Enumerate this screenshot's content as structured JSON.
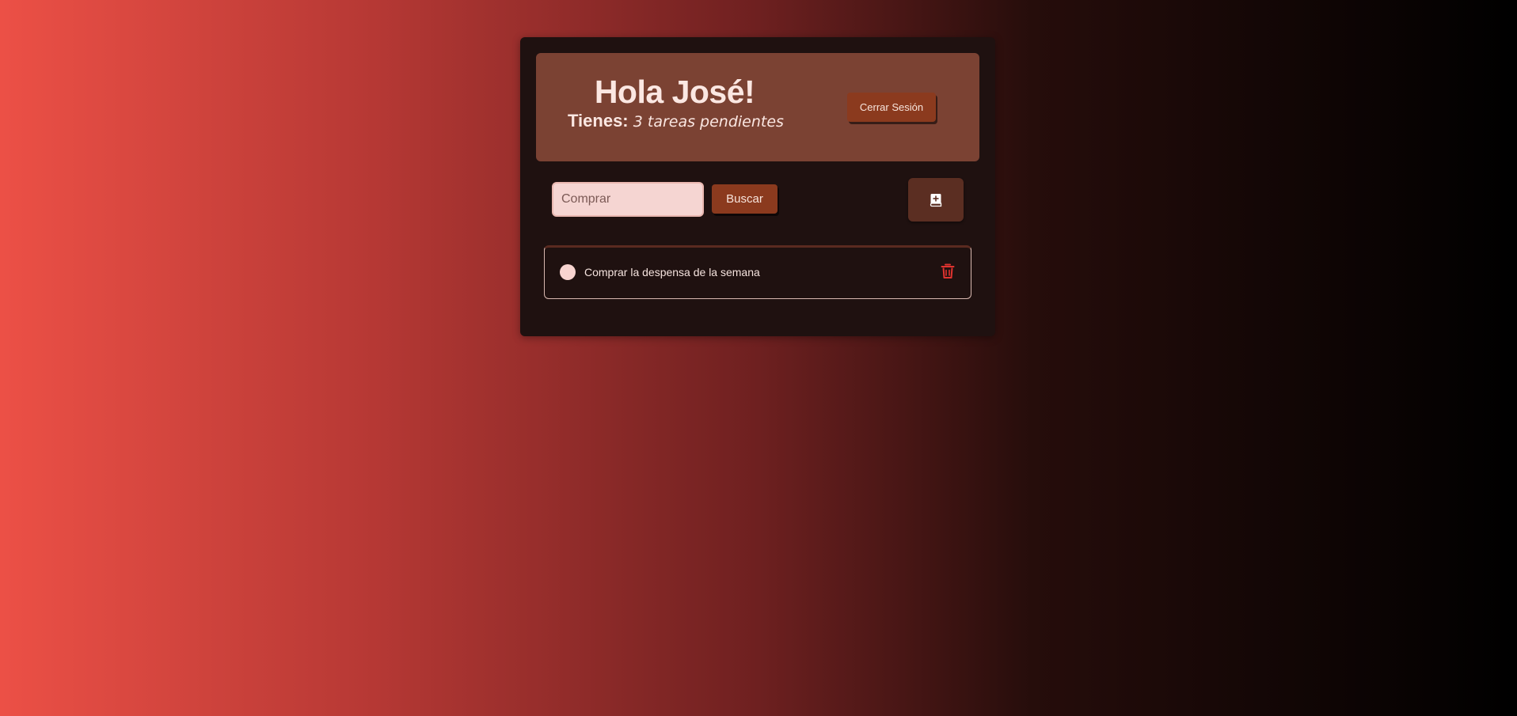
{
  "header": {
    "greeting": "Hola José!",
    "pending_label": "Tienes:",
    "pending_count_text": "3 tareas pendientes",
    "logout_label": "Cerrar Sesión"
  },
  "search": {
    "value": "",
    "placeholder": "Comprar",
    "button_label": "Buscar"
  },
  "add_task": {
    "icon": "add-note-icon"
  },
  "tasks": [
    {
      "text": "Comprar la despensa de la semana",
      "completed": false,
      "delete_icon": "trash-icon"
    }
  ],
  "colors": {
    "accent": "#8b3a1e",
    "header_bg": "#7b4233",
    "card_bg": "#1f1110",
    "delete": "#e0332f",
    "gradient_start": "#ec5046",
    "gradient_end": "#000000"
  }
}
